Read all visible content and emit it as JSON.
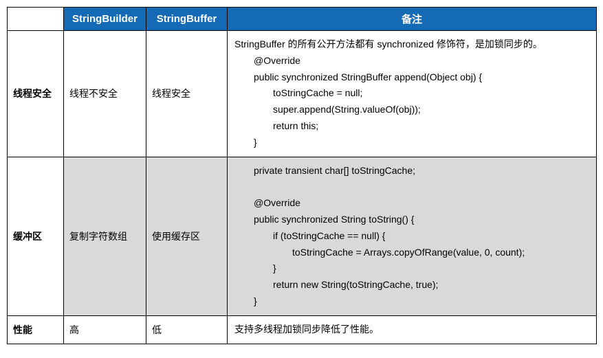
{
  "headers": {
    "col0": "",
    "col1": "StringBuilder",
    "col2": "StringBuffer",
    "col3": "备注"
  },
  "rows": [
    {
      "label": "线程安全",
      "builder": "线程不安全",
      "buffer": "线程安全",
      "remark": {
        "intro": "StringBuffer 的所有公开方法都有 synchronized 修饰符，是加锁同步的。",
        "code": [
          {
            "indent": 1,
            "text": "@Override"
          },
          {
            "indent": 1,
            "text": "public synchronized StringBuffer append(Object obj) {"
          },
          {
            "indent": 2,
            "text": "toStringCache = null;"
          },
          {
            "indent": 2,
            "text": "super.append(String.valueOf(obj));"
          },
          {
            "indent": 2,
            "text": "return this;"
          },
          {
            "indent": 1,
            "text": "}"
          }
        ]
      }
    },
    {
      "label": "缓冲区",
      "builder": "复制字符数组",
      "buffer": "使用缓存区",
      "remark": {
        "intro": "",
        "code": [
          {
            "indent": 1,
            "text": "private transient char[] toStringCache;"
          },
          {
            "indent": 1,
            "text": ""
          },
          {
            "indent": 1,
            "text": "@Override"
          },
          {
            "indent": 1,
            "text": "public synchronized String toString() {"
          },
          {
            "indent": 2,
            "text": "if (toStringCache == null) {"
          },
          {
            "indent": 3,
            "text": "toStringCache = Arrays.copyOfRange(value, 0, count);"
          },
          {
            "indent": 2,
            "text": "}"
          },
          {
            "indent": 2,
            "text": "return new String(toStringCache, true);"
          },
          {
            "indent": 1,
            "text": "}"
          }
        ]
      }
    },
    {
      "label": "性能",
      "builder": "高",
      "buffer": "低",
      "remark": {
        "intro": "支持多线程加锁同步降低了性能。",
        "code": []
      }
    }
  ]
}
